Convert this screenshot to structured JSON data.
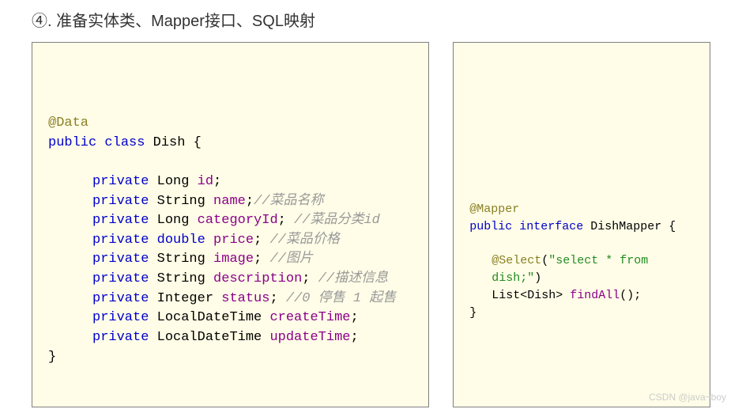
{
  "title": "④. 准备实体类、Mapper接口、SQL映射",
  "left": {
    "anno": "@Data",
    "kw_public": "public",
    "kw_class": "class",
    "classname": "Dish {",
    "fields": [
      {
        "kw": "private",
        "type": "Long",
        "name": "id",
        "semi": ";",
        "comment": ""
      },
      {
        "kw": "private",
        "type": "String",
        "name": "name",
        "semi": ";",
        "comment": "//菜品名称"
      },
      {
        "kw": "private",
        "type": "Long",
        "name": "categoryId",
        "semi": ";",
        "comment": "   //菜品分类id"
      },
      {
        "kw": "private",
        "type": "double",
        "name": "price",
        "semi": ";",
        "comment": "   //菜品价格"
      },
      {
        "kw": "private",
        "type": "String",
        "name": "image",
        "semi": ";",
        "comment": "   //图片"
      },
      {
        "kw": "private",
        "type": "String",
        "name": "description",
        "semi": ";",
        "comment": "   //描述信息"
      },
      {
        "kw": "private",
        "type": "Integer",
        "name": "status",
        "semi": ";",
        "comment": "   //0 停售 1 起售"
      },
      {
        "kw": "private",
        "type": "LocalDateTime",
        "name": "createTime",
        "semi": ";",
        "comment": ""
      },
      {
        "kw": "private",
        "type": "LocalDateTime",
        "name": "updateTime",
        "semi": ";",
        "comment": ""
      }
    ],
    "close": "}"
  },
  "right": {
    "anno": "@Mapper",
    "kw_public": "public",
    "kw_interface": "interface",
    "classname": "DishMapper {",
    "select_anno": "@Select",
    "select_open": "(",
    "select_str": "\"select * from dish;\"",
    "select_close": ")",
    "ret_type": "List<Dish>",
    "method": "findAll",
    "method_tail": "();",
    "close": "}"
  },
  "watermark": "CSDN @java~boy"
}
